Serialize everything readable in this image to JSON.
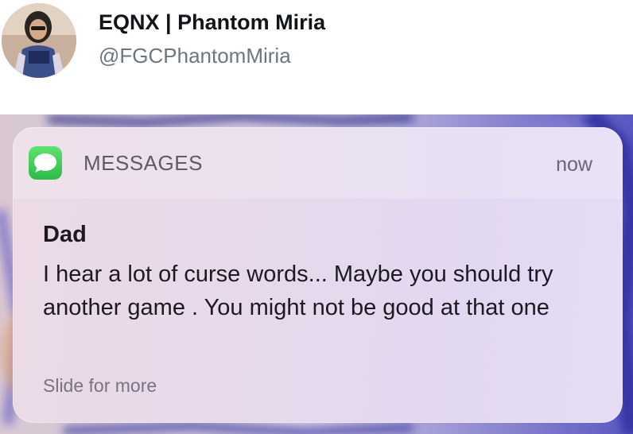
{
  "tweet": {
    "display_name": "EQNX | Phantom Miria",
    "handle": "@FGCPhantomMiria"
  },
  "notification": {
    "app_name": "MESSAGES",
    "time": "now",
    "sender": "Dad",
    "message": "I hear a lot of curse words... Maybe you should try another game . You might not be good at that one",
    "hint": "Slide for more",
    "app_icon": "messages-bubble-icon",
    "icon_color": "#34c759"
  },
  "colors": {
    "wallpaper_accent": "#3a3aa8",
    "card_tint": "#e6d9ec",
    "handle_gray": "#6b7680"
  }
}
